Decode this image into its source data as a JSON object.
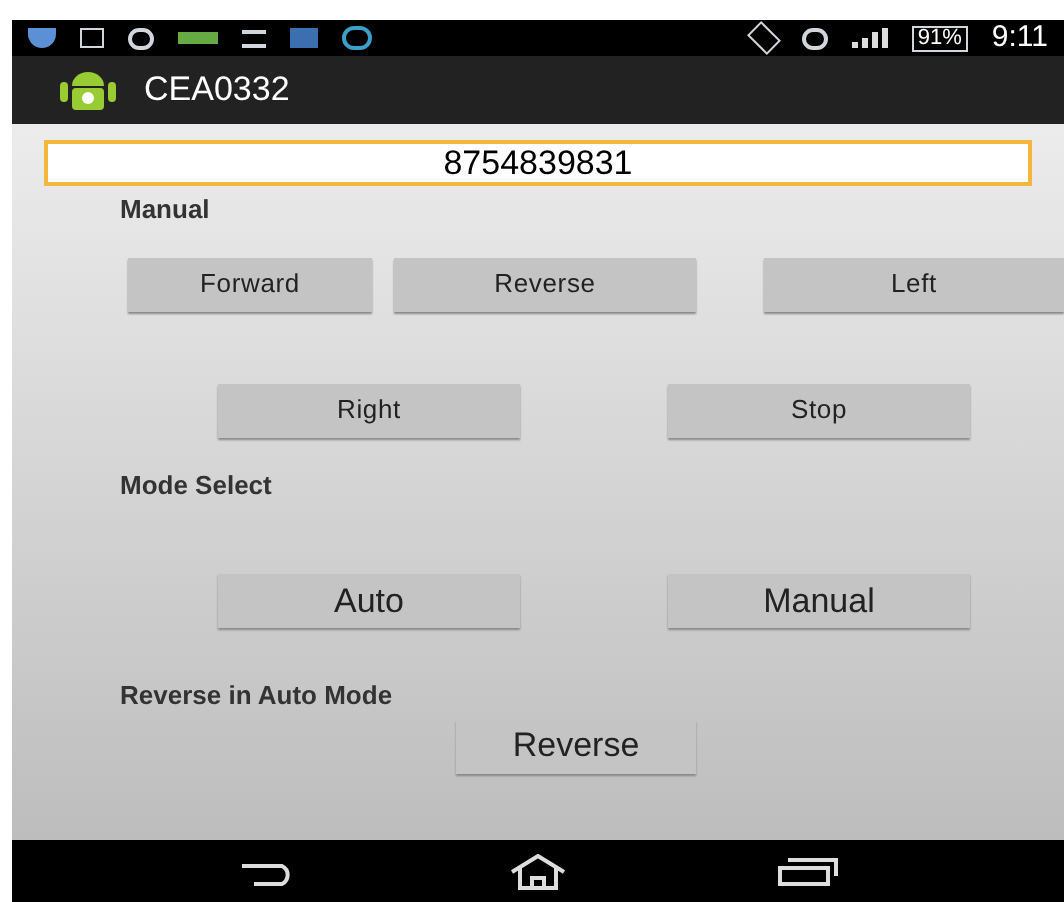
{
  "status_bar": {
    "battery": "91%",
    "time": "9:11"
  },
  "action_bar": {
    "title": "CEA0332"
  },
  "phone_field": {
    "value": "8754839831"
  },
  "manual": {
    "label": "Manual",
    "row_1": [
      "Forward",
      "Reverse",
      "Left"
    ],
    "row_2": [
      "Right",
      "Stop"
    ]
  },
  "mode_select": {
    "label": "Mode Select",
    "buttons": [
      "Auto",
      "Manual"
    ]
  },
  "auto_reverse": {
    "label": "Reverse in Auto Mode",
    "button": "Reverse"
  }
}
